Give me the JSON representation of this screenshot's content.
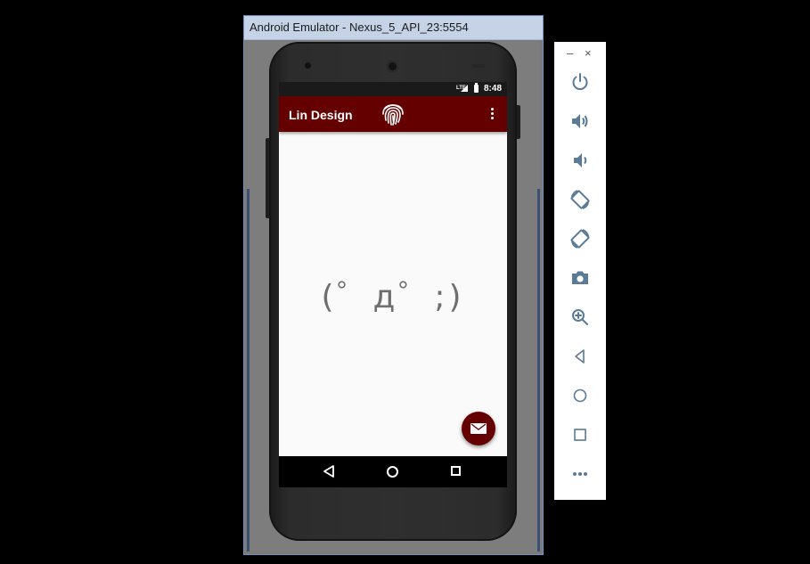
{
  "window": {
    "title": "Android Emulator - Nexus_5_API_23:5554"
  },
  "status_bar": {
    "network": "LTE",
    "time": "8:48"
  },
  "app_bar": {
    "title": "Lin Design",
    "center_icon": "fingerprint-icon",
    "menu_icon": "overflow-menu-icon"
  },
  "content": {
    "kaomoji": "(゜д゜;)"
  },
  "fab": {
    "icon": "mail-icon"
  },
  "nav_bar": {
    "buttons": [
      "back-icon",
      "home-icon",
      "recents-icon"
    ]
  },
  "toolbar": {
    "minimize": "–",
    "close": "×",
    "buttons": [
      "power-icon",
      "volume-up-icon",
      "volume-down-icon",
      "rotate-left-icon",
      "rotate-right-icon",
      "camera-icon",
      "zoom-icon",
      "back-icon",
      "home-icon",
      "overview-icon",
      "more-icon"
    ]
  },
  "colors": {
    "primary": "#650000",
    "toolbar_icon": "#5a7a96",
    "screen_bg": "#fafafa"
  }
}
